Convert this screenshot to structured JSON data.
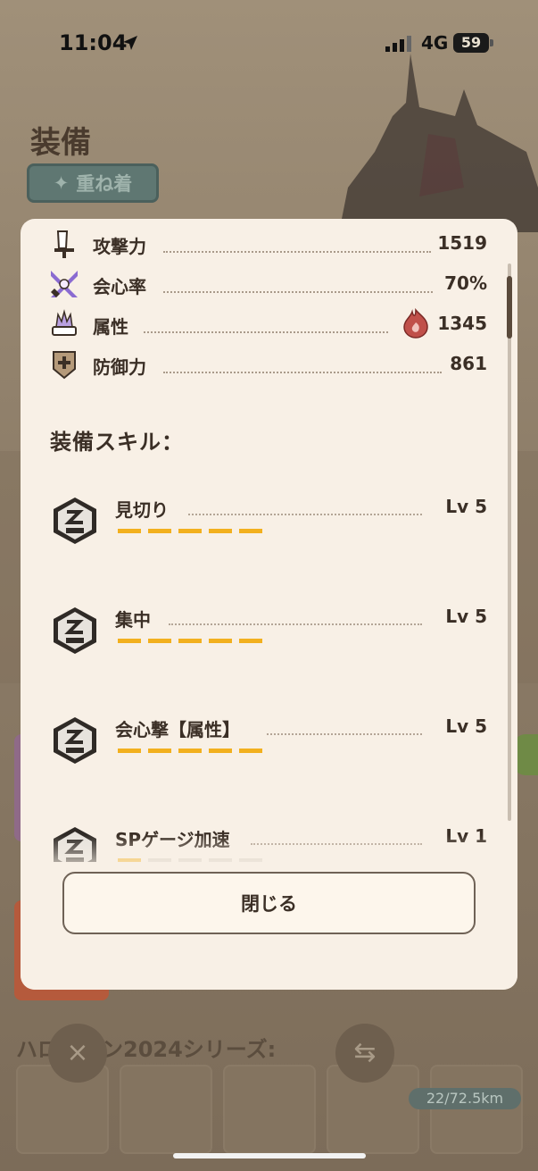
{
  "status_bar": {
    "time": "11:04",
    "network": "4G",
    "battery": "59"
  },
  "background": {
    "title": "装備",
    "layer_button": "重ね着",
    "series_label": "ハロウィン2024シリーズ:",
    "distance": "22/72.5km"
  },
  "stats": [
    {
      "label": "攻撃力",
      "value": "1519",
      "icon": "sword-icon"
    },
    {
      "label": "会心率",
      "value": "70%",
      "icon": "crossed-blades-icon"
    },
    {
      "label": "属性",
      "value": "1345",
      "icon": "flame-claw-icon",
      "element_icon": "fire-element-icon"
    },
    {
      "label": "防御力",
      "value": "861",
      "icon": "shield-icon"
    }
  ],
  "skills_heading": "装備スキル：",
  "skills": [
    {
      "name": "見切り",
      "level": "Lv 5",
      "level_value": 5,
      "max": 5
    },
    {
      "name": "集中",
      "level": "Lv 5",
      "level_value": 5,
      "max": 5
    },
    {
      "name": "会心撃【属性】",
      "level": "Lv 5",
      "level_value": 5,
      "max": 5
    },
    {
      "name": "SPゲージ加速",
      "level": "Lv 1",
      "level_value": 1,
      "max": 5
    }
  ],
  "close_button": "閉じる",
  "colors": {
    "accent": "#f2b01e",
    "panel": "#f8f0e6",
    "text": "#3b2f26"
  }
}
